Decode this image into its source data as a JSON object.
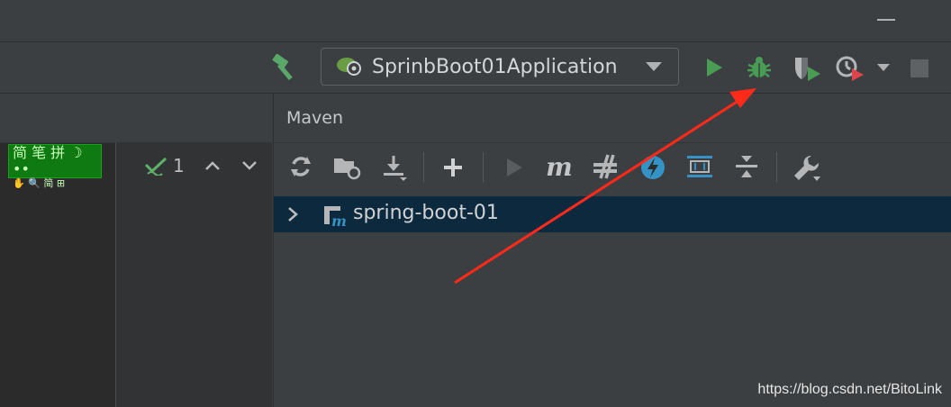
{
  "window": {
    "minimize_label": ""
  },
  "run_config": {
    "name": "SprinbBoot01Application"
  },
  "toolbar": {
    "icons": [
      "hammer-icon",
      "spring-boot-icon",
      "run-icon",
      "debug-icon",
      "coverage-icon",
      "profile-icon",
      "chevron-down-icon",
      "stop-icon"
    ]
  },
  "ime_widget": {
    "line1": "简 笔 拼 ☽ ••",
    "line2": "✋ 🔍 简 ⊞"
  },
  "problems": {
    "count": "1"
  },
  "maven": {
    "title": "Maven",
    "toolbar_icons": [
      "reload-icon",
      "add-folder-icon",
      "download-icon",
      "plus-icon",
      "run-maven-icon",
      "execute-goal-icon",
      "toggle-offline-icon",
      "skip-tests-icon",
      "show-dependencies-icon",
      "collapse-all-icon",
      "settings-wrench-icon"
    ],
    "projects": [
      {
        "name": "spring-boot-01",
        "icon": "maven-module-icon"
      }
    ]
  },
  "watermark": "https://blog.csdn.net/BitoLink",
  "colors": {
    "accent_run": "#499c54",
    "arrow": "#ff2a1a",
    "selection": "#0d293e"
  }
}
